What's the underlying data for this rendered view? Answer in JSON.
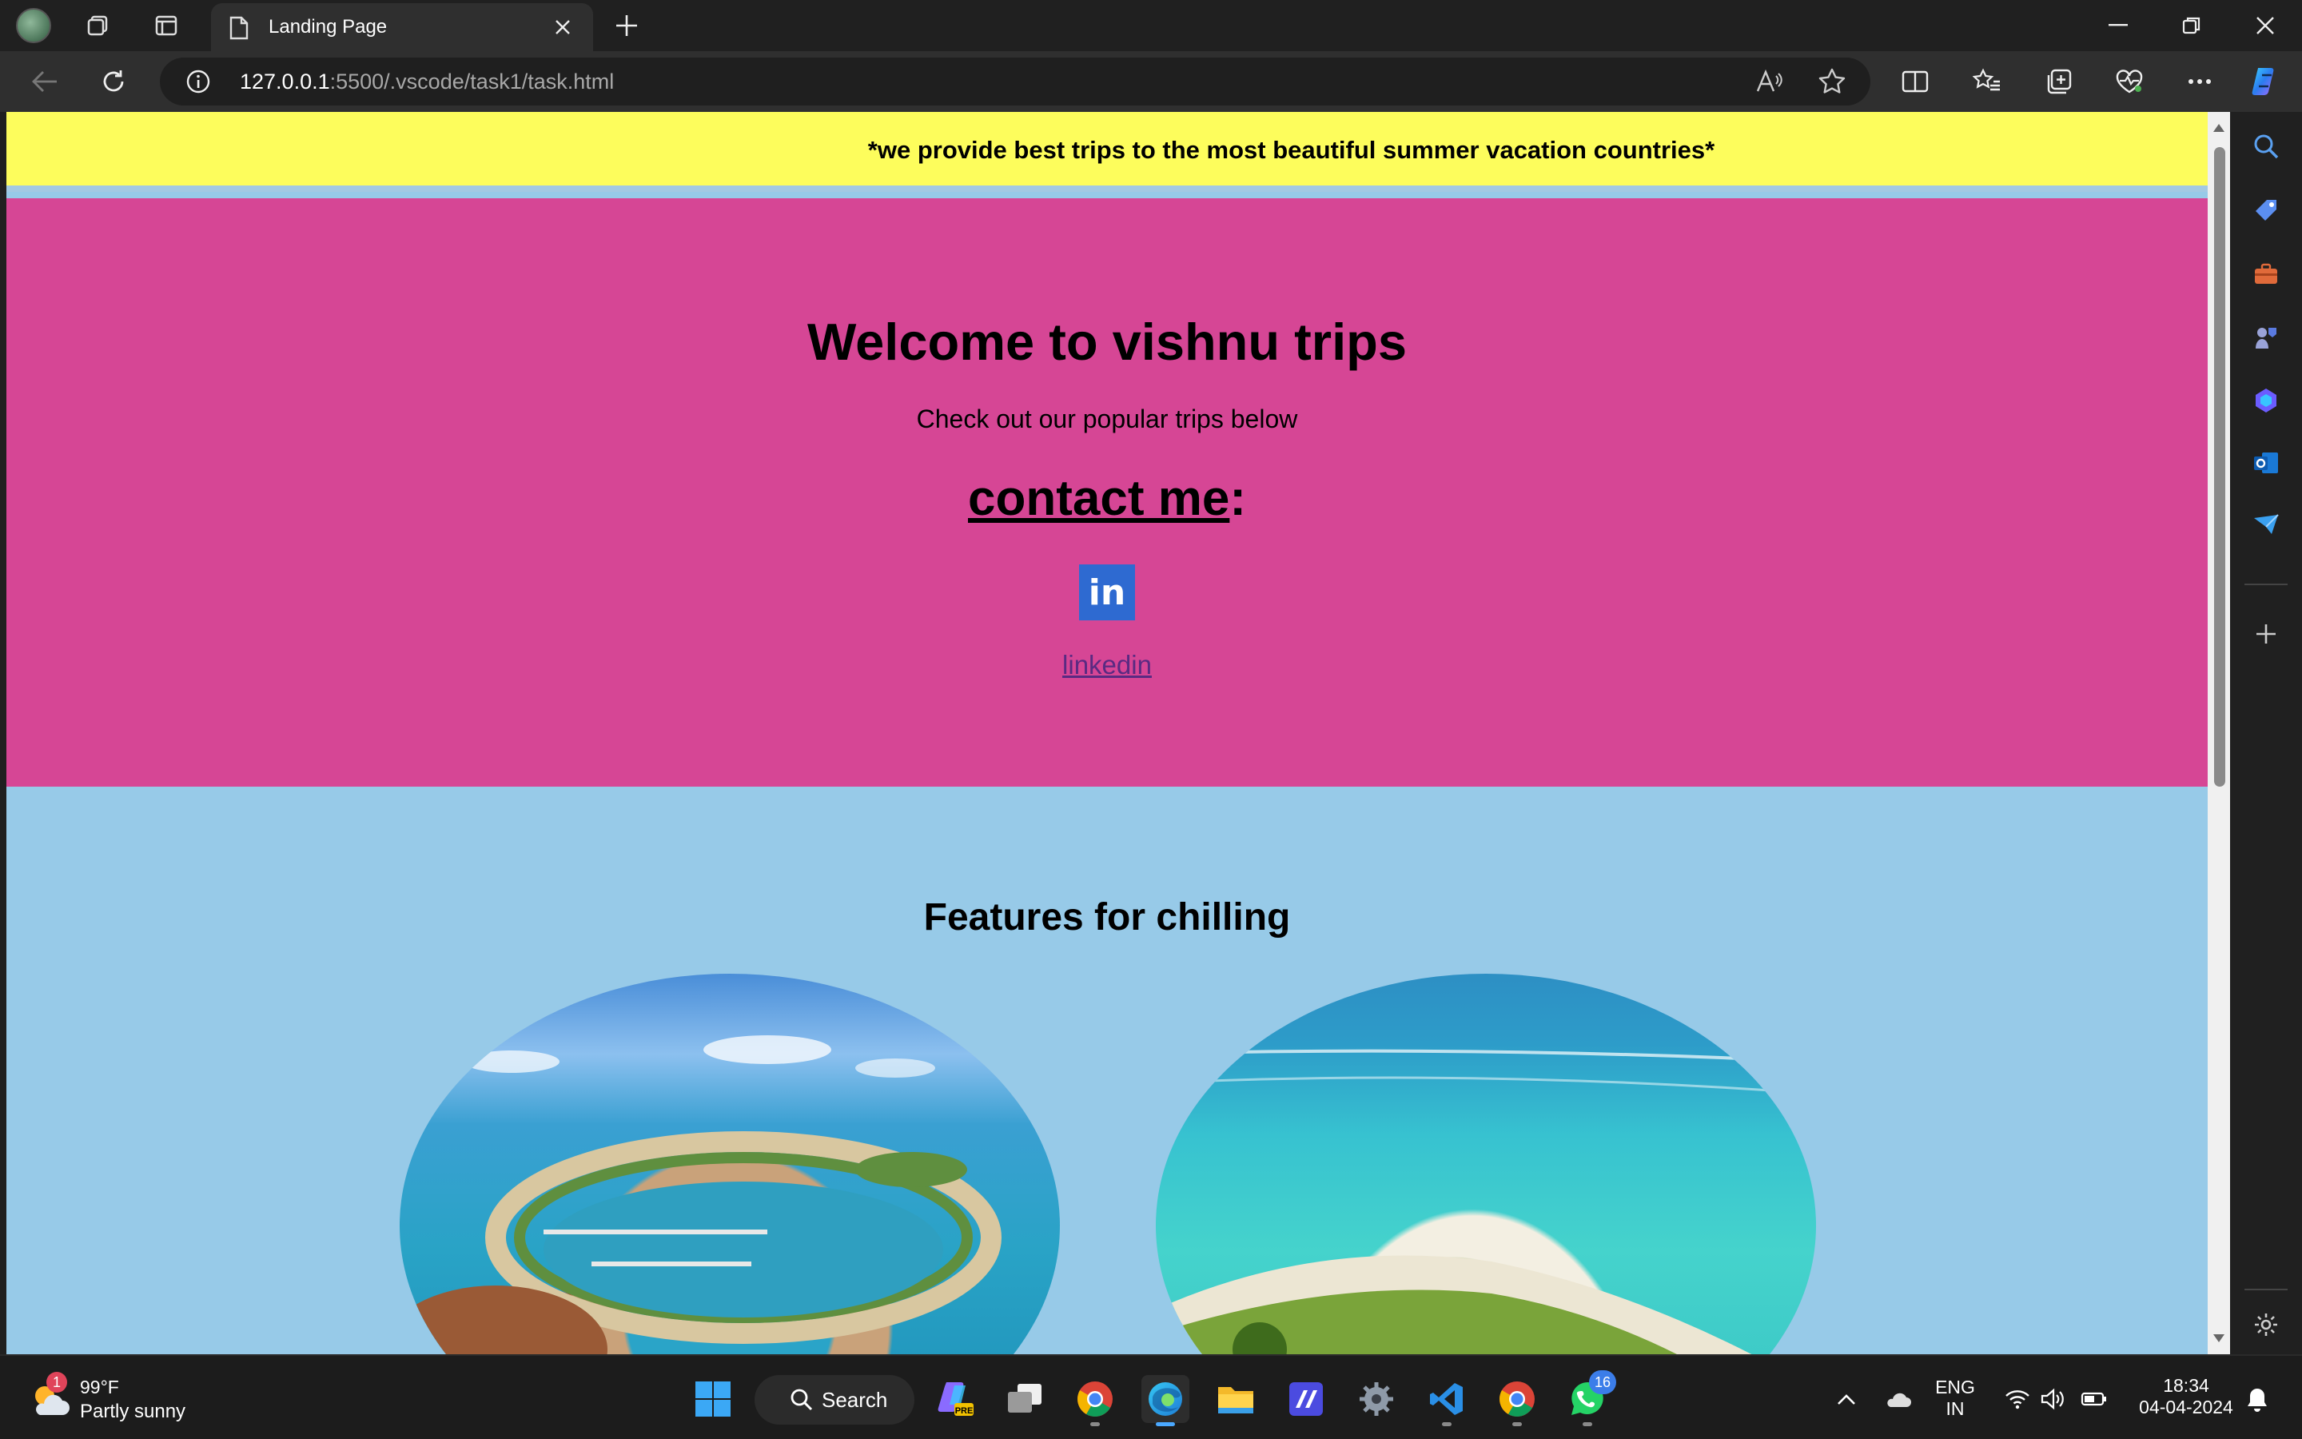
{
  "browser": {
    "tab_title": "Landing Page",
    "url_host": "127.0.0.1",
    "url_rest": ":5500/.vscode/task1/task.html"
  },
  "page": {
    "banner": "*we provide best trips to the most beautiful summer vacation countries*",
    "heading": "Welcome to vishnu trips",
    "subheading": "Check out our popular trips below",
    "contact_label": "contact me",
    "contact_colon": ":",
    "linkedin_logo_text": "in",
    "linkedin_link": "linkedin",
    "features_title": "Features for chilling"
  },
  "taskbar": {
    "weather_badge": "1",
    "weather_temp": "99°F",
    "weather_condition": "Partly sunny",
    "search_label": "Search",
    "whatsapp_badge": "16",
    "lang_line1": "ENG",
    "lang_line2": "IN",
    "time": "18:34",
    "date": "04-04-2024"
  },
  "colors": {
    "banner_bg": "#fdfd5c",
    "hero_bg": "#d64695",
    "features_bg": "#97cae8",
    "linkedin_blue": "#2e6ad1"
  }
}
